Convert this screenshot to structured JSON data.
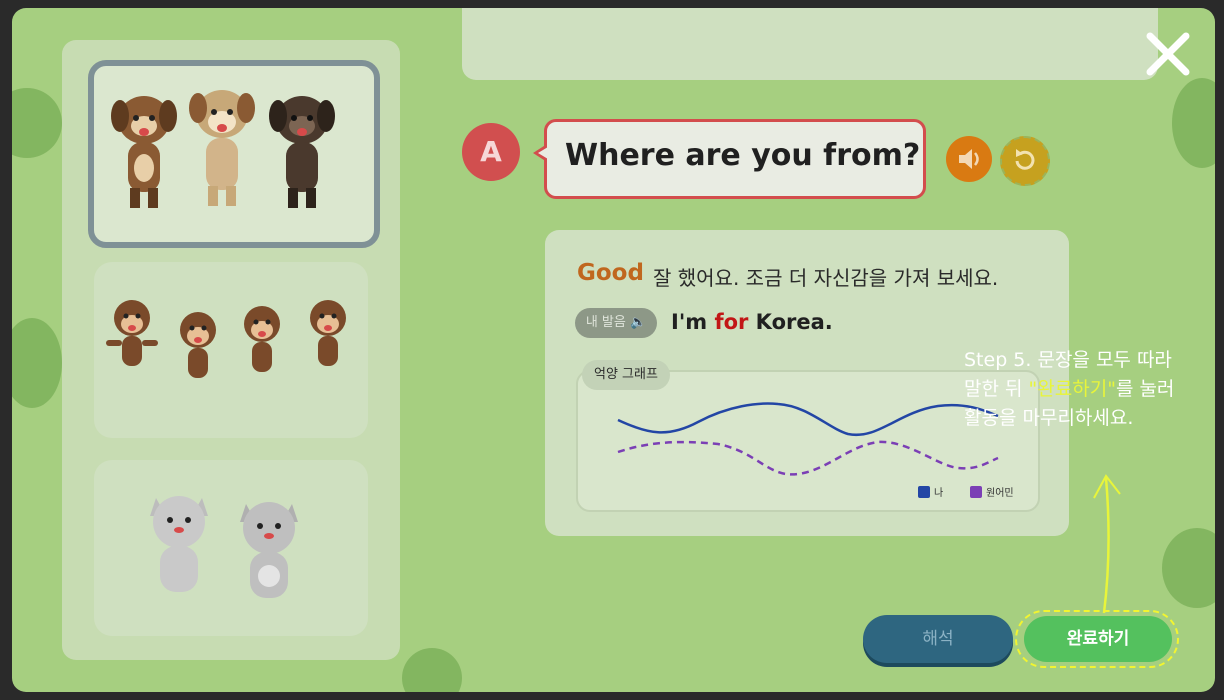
{
  "modal": {
    "close_label": "close",
    "avatar_letter": "A",
    "sentence": "Where are you from?"
  },
  "result": {
    "grade": "Good",
    "feedback": "잘 했어요. 조금 더 자신감을 가져 보세요.",
    "my_pron_label": "내 발음",
    "pron_words": [
      "I'm",
      "for",
      "Korea."
    ],
    "graph_title": "억양 그래프",
    "legend_me": "나",
    "legend_native": "원어민"
  },
  "guide": {
    "line1": "Step 5. 문장을 모두 따라",
    "line2_pre": "말한 뒤 ",
    "line2_hl": "\"완료하기\"",
    "line2_post": "를 눌러",
    "line3": "활동을 마무리하세요."
  },
  "buttons": {
    "interpret": "해석",
    "done": "완료하기"
  },
  "colors": {
    "modal_bg": "#a6cf80",
    "accent_red": "#d34d4d",
    "done_green": "#54c15e",
    "highlight_yellow": "#e8f53a",
    "my_line": "#2346a5",
    "native_line": "#7b3fb5"
  },
  "icons": [
    "close-icon",
    "speaker-icon",
    "replay-icon",
    "dog-icon",
    "monkey-icon",
    "cat-icon"
  ]
}
